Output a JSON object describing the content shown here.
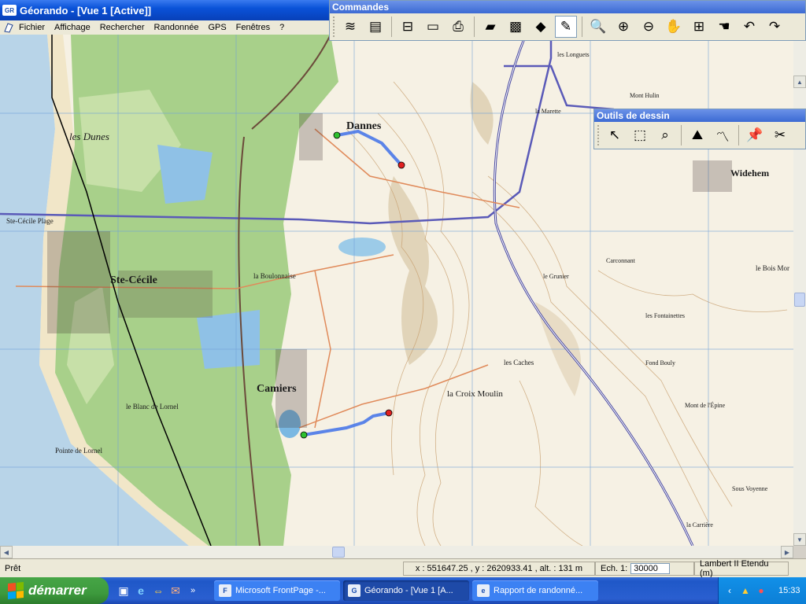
{
  "window": {
    "title": "Géorando - [Vue 1 [Active]]",
    "app_icon_text": "GR"
  },
  "menu": [
    "Fichier",
    "Affichage",
    "Rechercher",
    "Randonnée",
    "GPS",
    "Fenêtres",
    "?"
  ],
  "commandes": {
    "title": "Commandes",
    "tools": [
      {
        "name": "layers-icon",
        "glyph": "≋"
      },
      {
        "name": "legend-icon",
        "glyph": "▤"
      },
      {
        "name": "scale-icon",
        "glyph": "⊟"
      },
      {
        "name": "ruler-icon",
        "glyph": "▭"
      },
      {
        "name": "print-icon",
        "glyph": "⎙"
      },
      {
        "name": "export-map-icon",
        "glyph": "▰"
      },
      {
        "name": "tile-icon",
        "glyph": "▩"
      },
      {
        "name": "sign-icon",
        "glyph": "◆"
      },
      {
        "name": "pencil-icon",
        "glyph": "✎"
      },
      {
        "name": "globe-zoom-icon",
        "glyph": "🔍"
      },
      {
        "name": "zoom-in-icon",
        "glyph": "⊕"
      },
      {
        "name": "zoom-out-icon",
        "glyph": "⊖"
      },
      {
        "name": "hand-pan-icon",
        "glyph": "✋"
      },
      {
        "name": "zoom-window-icon",
        "glyph": "⊞"
      },
      {
        "name": "grab-icon",
        "glyph": "☚"
      },
      {
        "name": "undo-icon",
        "glyph": "↶"
      },
      {
        "name": "redo-icon",
        "glyph": "↷"
      }
    ]
  },
  "outils_dessin": {
    "title": "Outils de dessin",
    "tools": [
      {
        "name": "arrow-select-icon",
        "glyph": "↖"
      },
      {
        "name": "rect-select-icon",
        "glyph": "⬚"
      },
      {
        "name": "zoom-select-icon",
        "glyph": "⌕"
      },
      {
        "name": "profile-icon",
        "glyph": "⛰"
      },
      {
        "name": "route-draw-icon",
        "glyph": "〽"
      },
      {
        "name": "pin-icon",
        "glyph": "📌"
      },
      {
        "name": "scissors-icon",
        "glyph": "✂"
      }
    ]
  },
  "map": {
    "labels": [
      {
        "text": "Dannes"
      },
      {
        "text": "les Dunes"
      },
      {
        "text": "Ste-Cécile Plage"
      },
      {
        "text": "Ste-Cécile"
      },
      {
        "text": "Camiers"
      },
      {
        "text": "Widehem"
      },
      {
        "text": "la Boulonnaise"
      },
      {
        "text": "le Blanc de Lornel"
      },
      {
        "text": "Pointe de Lornel"
      },
      {
        "text": "la Croix Moulin"
      },
      {
        "text": "Mont de l'Épine"
      },
      {
        "text": "Sous Voyenne"
      },
      {
        "text": "le Bois Mor"
      },
      {
        "text": "les Caches"
      },
      {
        "text": "la Carrière"
      },
      {
        "text": "les Fontainettes"
      },
      {
        "text": "Carconnant"
      },
      {
        "text": "Mont Hulin"
      },
      {
        "text": "Fond Bouly"
      },
      {
        "text": "le Grunier"
      },
      {
        "text": "la Marette"
      },
      {
        "text": "les Longuets"
      }
    ],
    "colors": {
      "sea": "#b8d4e8",
      "forest": "#a8d08a",
      "grid": "#6fa0d8",
      "route": "#4a78e8"
    }
  },
  "status": {
    "ready": "Prêt",
    "coords": "x : 551647.25 , y : 2620933.41 , alt. : 131 m",
    "scale_label": "Ech. 1:",
    "scale_value": "30000",
    "projection": "Lambert II Etendu (m)"
  },
  "taskbar": {
    "start_label": "démarrer",
    "tasks": [
      {
        "label": "Microsoft FrontPage -...",
        "icon": "F",
        "active": false
      },
      {
        "label": "Géorando - [Vue 1 [A...",
        "icon": "G",
        "active": true
      },
      {
        "label": "Rapport de randonné...",
        "icon": "e",
        "active": false
      }
    ],
    "clock": "15:33"
  }
}
